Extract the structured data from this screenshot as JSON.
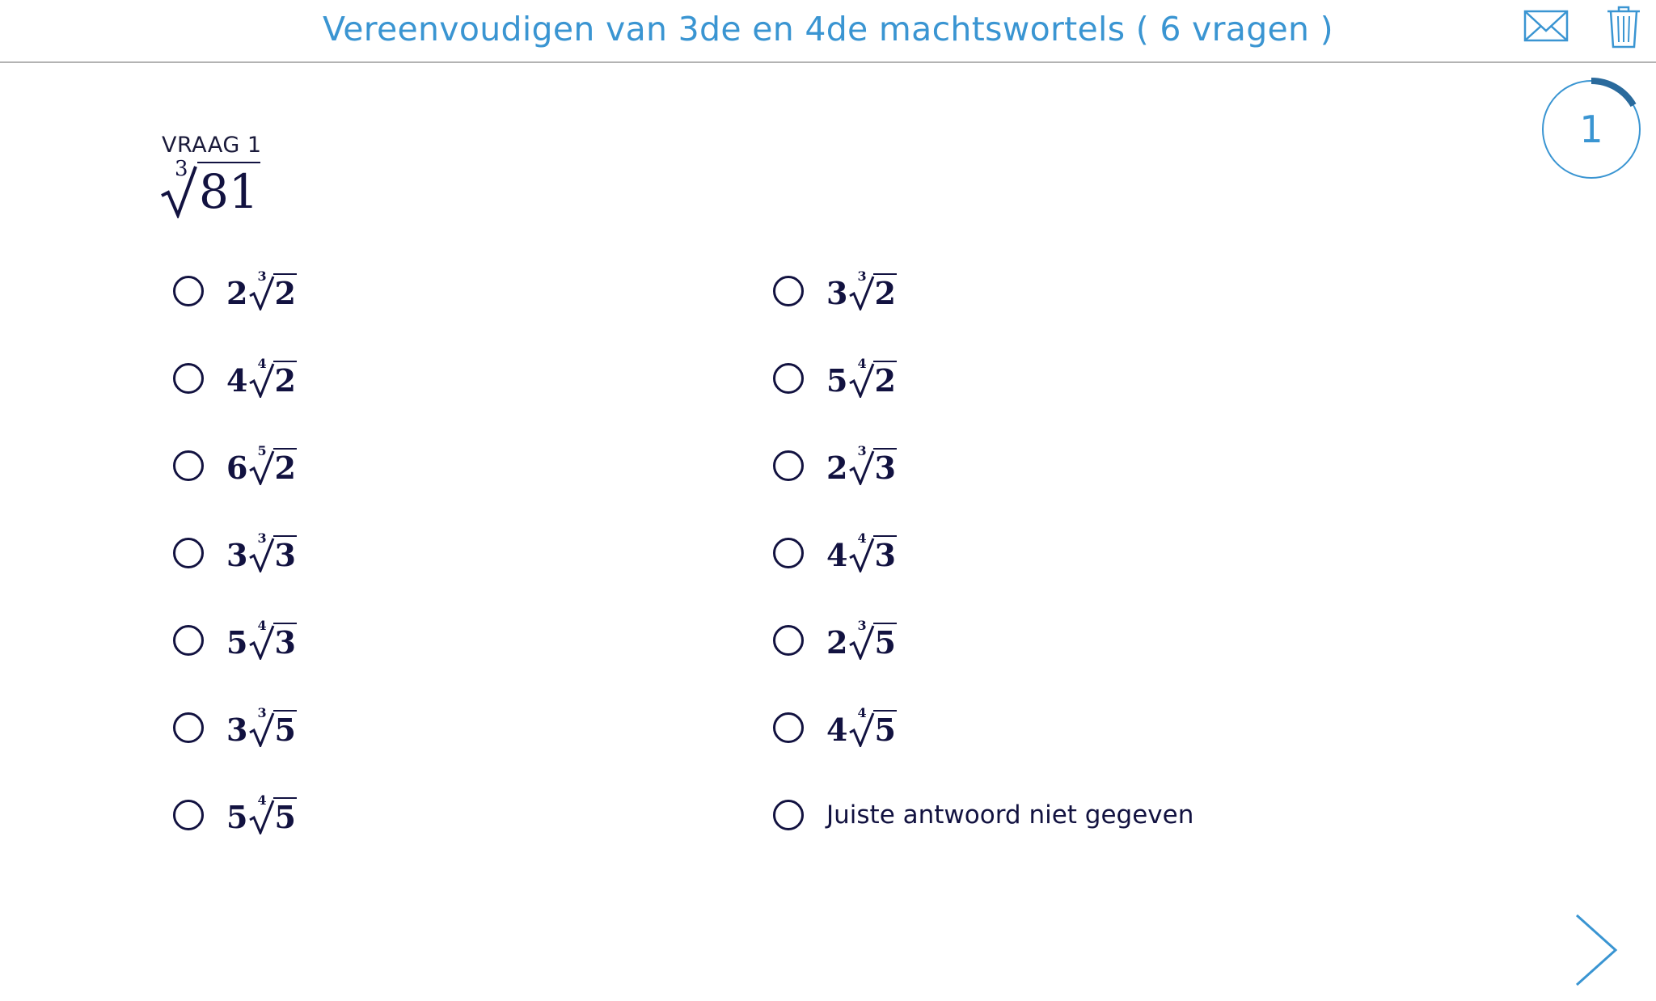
{
  "header": {
    "title": "Vereenvoudigen van 3de en 4de machtswortels ( 6 vragen )",
    "mail_icon": "envelope-icon",
    "trash_icon": "trash-icon"
  },
  "progress": {
    "number": "1",
    "fraction": 0.167
  },
  "question": {
    "label": "VRAAG 1",
    "index": "3",
    "radicand": "81"
  },
  "options": [
    {
      "coef": "2",
      "index": "3",
      "radicand": "2"
    },
    {
      "coef": "3",
      "index": "3",
      "radicand": "2"
    },
    {
      "coef": "4",
      "index": "4",
      "radicand": "2"
    },
    {
      "coef": "5",
      "index": "4",
      "radicand": "2"
    },
    {
      "coef": "6",
      "index": "5",
      "radicand": "2"
    },
    {
      "coef": "2",
      "index": "3",
      "radicand": "3"
    },
    {
      "coef": "3",
      "index": "3",
      "radicand": "3"
    },
    {
      "coef": "4",
      "index": "4",
      "radicand": "3"
    },
    {
      "coef": "5",
      "index": "4",
      "radicand": "3"
    },
    {
      "coef": "2",
      "index": "3",
      "radicand": "5"
    },
    {
      "coef": "3",
      "index": "3",
      "radicand": "5"
    },
    {
      "coef": "4",
      "index": "4",
      "radicand": "5"
    },
    {
      "coef": "5",
      "index": "4",
      "radicand": "5"
    },
    {
      "text": "Juiste antwoord niet gegeven"
    }
  ],
  "colors": {
    "accent": "#3a95d2",
    "progress_arc": "#2a6a9c",
    "text": "#121240"
  },
  "navigation": {
    "next_icon": "chevron-right-icon"
  }
}
